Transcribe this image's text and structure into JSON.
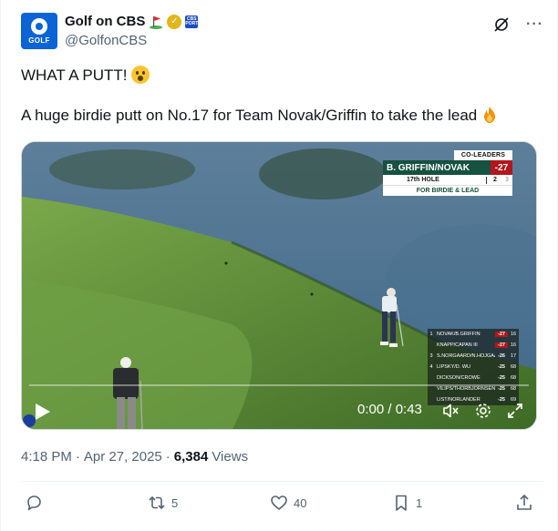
{
  "account": {
    "display_name": "Golf on CBS",
    "handle": "@GolfonCBS",
    "avatar_text": "GOLF",
    "affiliate_badge_text": "CBS\nSPORTS"
  },
  "tweet": {
    "line1": "WHAT A PUTT!",
    "line2": "A huge birdie putt on No.17 for Team Novak/Griffin to take the lead"
  },
  "video": {
    "graphic": {
      "header": "CO-LEADERS",
      "team": "B. GRIFFIN/NOVAK",
      "score": "-27",
      "hole": "17th HOLE",
      "shot_current": "2",
      "shot_next": "3",
      "caption": "FOR BIRDIE & LEAD"
    },
    "leaderboard": [
      {
        "pos": "1",
        "name": "NOVAK/B.GRIFFIN",
        "score": "-27",
        "thru": "16",
        "lead": true
      },
      {
        "pos": "",
        "name": "KNAPP/CAPAN III",
        "score": "-27",
        "thru": "16",
        "lead": true
      },
      {
        "pos": "3",
        "name": "S.NORGAARD/N.HOJGAARD",
        "score": "-26",
        "thru": "17",
        "lead": false
      },
      {
        "pos": "4",
        "name": "LIPSKY/D. WU",
        "score": "-25",
        "thru": "68",
        "lead": false
      },
      {
        "pos": "",
        "name": "DICKSON/CROWE",
        "score": "-25",
        "thru": "68",
        "lead": false
      },
      {
        "pos": "",
        "name": "VILIPS/THORBJORNSEN",
        "score": "-25",
        "thru": "68",
        "lead": false
      },
      {
        "pos": "",
        "name": "LIST/NORLANDER",
        "score": "-25",
        "thru": "69",
        "lead": false
      }
    ],
    "time": "0:00 / 0:43",
    "progress": 0
  },
  "meta": {
    "time": "4:18 PM",
    "separator": "·",
    "date": "Apr 27, 2025",
    "views_count": "6,384",
    "views_label": "Views"
  },
  "actions": {
    "replies": "",
    "reposts": "5",
    "likes": "40",
    "bookmarks": "1"
  },
  "icons": [
    "golf-flag-icon",
    "verified-icon",
    "grok-icon",
    "more-icon",
    "play-icon",
    "volume-icon",
    "settings-icon",
    "fullscreen-icon",
    "reply-icon",
    "repost-icon",
    "like-icon",
    "bookmark-icon",
    "share-icon"
  ],
  "colors": {
    "avatar_blue": "#0a64d6",
    "verified_gold": "#e2b719",
    "graphic_green": "#17513f",
    "score_red": "#b3161c",
    "text_secondary": "#536471"
  }
}
